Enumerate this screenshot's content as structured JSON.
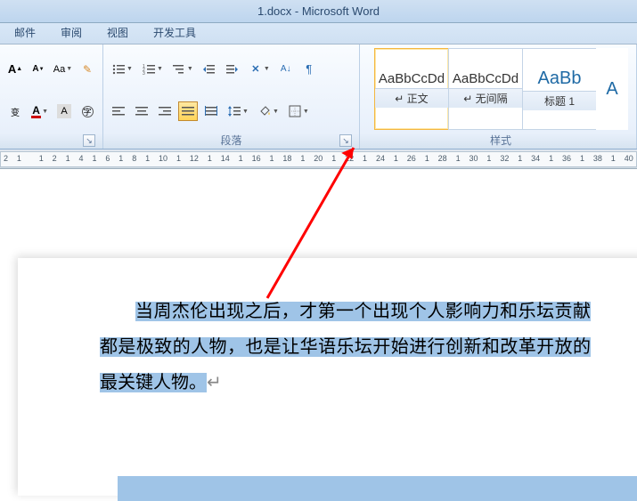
{
  "title": "1.docx - Microsoft Word",
  "tabs": [
    "邮件",
    "审阅",
    "视图",
    "开发工具"
  ],
  "groups": {
    "paragraph": "段落",
    "styles": "样式"
  },
  "font_row1": {
    "grow": "A",
    "shrink": "A",
    "phonetic": "拼",
    "clear": "◇",
    "border": "囗"
  },
  "font_row2": {
    "fontcolor": "A",
    "highlight": "ab",
    "change_case": "Aa"
  },
  "paragraph_row1": {
    "bullet": "•",
    "number": "1",
    "multilevel": "a",
    "indent_dec": "←",
    "indent_inc": "→",
    "sort": "A↓",
    "showmarks": "¶"
  },
  "paragraph_row2": {
    "align_left": "≡",
    "align_center": "≡",
    "align_right": "≡",
    "align_justify": "≡",
    "line_spacing": "‡",
    "shading": "◪",
    "borders": "田"
  },
  "styles": [
    {
      "preview": "AaBbCcDd",
      "name": "↵ 正文",
      "active": true
    },
    {
      "preview": "AaBbCcDd",
      "name": "↵ 无间隔",
      "active": false
    },
    {
      "preview": "AaBb",
      "name": "标题 1",
      "blue": true,
      "active": false
    }
  ],
  "style_partial": "A",
  "ruler": [
    "2",
    "1",
    "",
    "1",
    "2",
    "1",
    "4",
    "1",
    "6",
    "1",
    "8",
    "1",
    "10",
    "1",
    "12",
    "1",
    "14",
    "1",
    "16",
    "1",
    "18",
    "1",
    "20",
    "1",
    "22",
    "1",
    "24",
    "1",
    "26",
    "1",
    "28",
    "1",
    "30",
    "1",
    "32",
    "1",
    "34",
    "1",
    "36",
    "1",
    "38",
    "1",
    "40"
  ],
  "doc": {
    "p1": "当周杰伦出现之后，才第一个出现个人影响力和乐坛贡献都是极致的人物，也是让华语乐坛开始进行创新和改革开放的最关键人物。"
  }
}
